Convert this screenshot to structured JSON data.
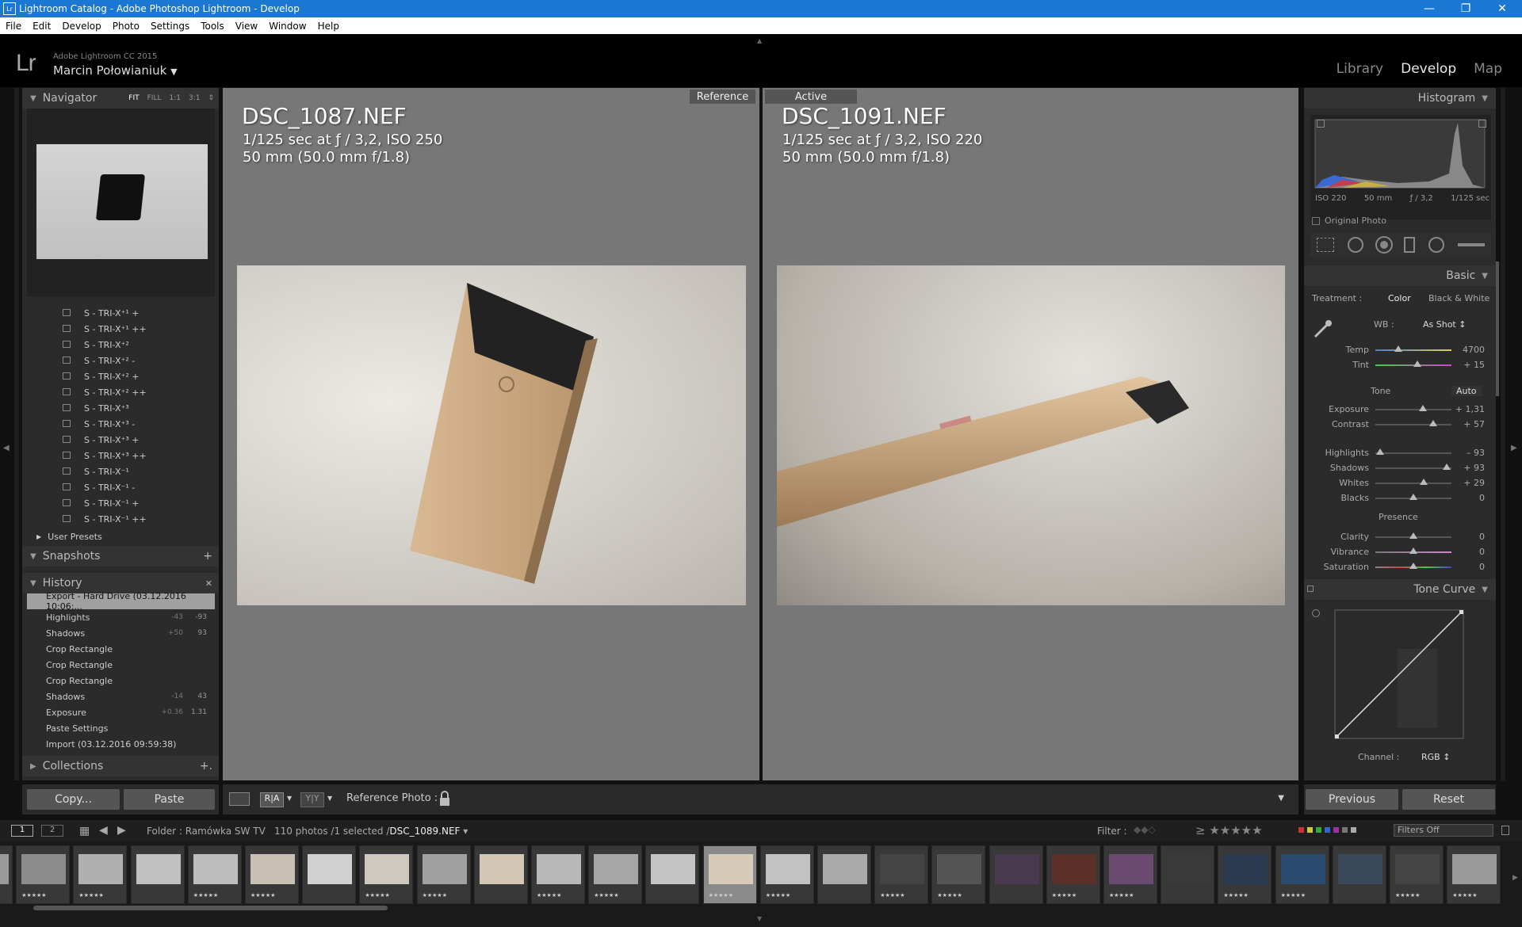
{
  "window": {
    "title": "Lightroom Catalog - Adobe Photoshop Lightroom - Develop",
    "app_badge": "Lr",
    "minimize": "—",
    "restore": "❐",
    "close": "✕"
  },
  "menu": [
    "File",
    "Edit",
    "Develop",
    "Photo",
    "Settings",
    "Tools",
    "View",
    "Window",
    "Help"
  ],
  "identity": {
    "logo": "Lr",
    "app_version": "Adobe Lightroom CC 2015",
    "user": "Marcin Połowianiuk",
    "user_caret": "▼"
  },
  "modules": {
    "library": "Library",
    "develop": "Develop",
    "map": "Map"
  },
  "navigator": {
    "title": "Navigator",
    "opts": [
      "FIT",
      "FILL",
      "1:1",
      "3:1"
    ],
    "opts_more": "⇕"
  },
  "presets": [
    "S - TRI-X⁺¹ +",
    "S - TRI-X⁺¹ ++",
    "S - TRI-X⁺²",
    "S - TRI-X⁺² -",
    "S - TRI-X⁺² +",
    "S - TRI-X⁺² ++",
    "S - TRI-X⁺³",
    "S - TRI-X⁺³ -",
    "S - TRI-X⁺³ +",
    "S - TRI-X⁺³ ++",
    "S - TRI-X⁻¹",
    "S - TRI-X⁻¹ -",
    "S - TRI-X⁻¹ +",
    "S - TRI-X⁻¹ ++"
  ],
  "user_presets": "User Presets",
  "snapshots": {
    "title": "Snapshots",
    "add": "+"
  },
  "history": {
    "title": "History",
    "clear": "✕",
    "items": [
      {
        "label": "Export - Hard Drive (03.12.2016 10:06:...",
        "v1": "",
        "v2": ""
      },
      {
        "label": "Highlights",
        "v1": "-43",
        "v2": "-93"
      },
      {
        "label": "Shadows",
        "v1": "+50",
        "v2": "93"
      },
      {
        "label": "Crop Rectangle",
        "v1": "",
        "v2": ""
      },
      {
        "label": "Crop Rectangle",
        "v1": "",
        "v2": ""
      },
      {
        "label": "Crop Rectangle",
        "v1": "",
        "v2": ""
      },
      {
        "label": "Shadows",
        "v1": "-14",
        "v2": "43"
      },
      {
        "label": "Exposure",
        "v1": "+0.36",
        "v2": "1.31"
      },
      {
        "label": "Paste Settings",
        "v1": "",
        "v2": ""
      },
      {
        "label": "Import (03.12.2016 09:59:38)",
        "v1": "",
        "v2": ""
      }
    ]
  },
  "collections": {
    "title": "Collections",
    "add": "+."
  },
  "left_buttons": {
    "copy": "Copy...",
    "paste": "Paste"
  },
  "reference": {
    "tag": "Reference",
    "filename": "DSC_1087.NEF",
    "exposure": "1/125 sec at ƒ / 3,2, ISO 250",
    "lens": "50 mm (50.0 mm f/1.8)"
  },
  "active": {
    "tag": "Active",
    "filename": "DSC_1091.NEF",
    "exposure": "1/125 sec at ƒ / 3,2, ISO 220",
    "lens": "50 mm (50.0 mm f/1.8)"
  },
  "toolbar": {
    "view_ra": "R|A",
    "view_yy": "Y|Y",
    "ref_photo_label": "Reference Photo :",
    "expand": "▼"
  },
  "histogram": {
    "title": "Histogram",
    "iso": "ISO 220",
    "focal": "50 mm",
    "aperture": "ƒ / 3,2",
    "shutter": "1/125 sec",
    "original_photo": "Original Photo"
  },
  "basic": {
    "title": "Basic",
    "treatment_label": "Treatment :",
    "color": "Color",
    "bw": "Black & White",
    "wb_label": "WB :",
    "wb_value": "As Shot ↕",
    "tone_label": "Tone",
    "auto": "Auto",
    "presence_label": "Presence",
    "sliders": [
      {
        "label": "Temp",
        "value": "4700",
        "pos": 0.3
      },
      {
        "label": "Tint",
        "value": "+ 15",
        "pos": 0.55
      },
      {
        "label": "Exposure",
        "value": "+ 1,31",
        "pos": 0.62
      },
      {
        "label": "Contrast",
        "value": "+ 57",
        "pos": 0.76
      },
      {
        "label": "Highlights",
        "value": "– 93",
        "pos": 0.06
      },
      {
        "label": "Shadows",
        "value": "+ 93",
        "pos": 0.94
      },
      {
        "label": "Whites",
        "value": "+ 29",
        "pos": 0.64
      },
      {
        "label": "Blacks",
        "value": "0",
        "pos": 0.5
      },
      {
        "label": "Clarity",
        "value": "0",
        "pos": 0.5
      },
      {
        "label": "Vibrance",
        "value": "0",
        "pos": 0.5
      },
      {
        "label": "Saturation",
        "value": "0",
        "pos": 0.5
      }
    ]
  },
  "tone_curve": {
    "title": "Tone Curve",
    "channel_label": "Channel :",
    "channel_value": "RGB ↕"
  },
  "right_buttons": {
    "previous": "Previous",
    "reset": "Reset"
  },
  "filmstrip": {
    "screen1": "1",
    "screen2": "2",
    "folder": "Folder : Ramówka SW TV",
    "count": "110 photos /1 selected /",
    "selected_file": "DSC_1089.NEF",
    "filter_label": "Filter :",
    "filters_off": "Filters Off",
    "thumb_count": 27,
    "selected_index": 13
  },
  "colors": {
    "accent": "#1a78d2",
    "panel": "#2b2b2b",
    "canvas": "#777777"
  }
}
